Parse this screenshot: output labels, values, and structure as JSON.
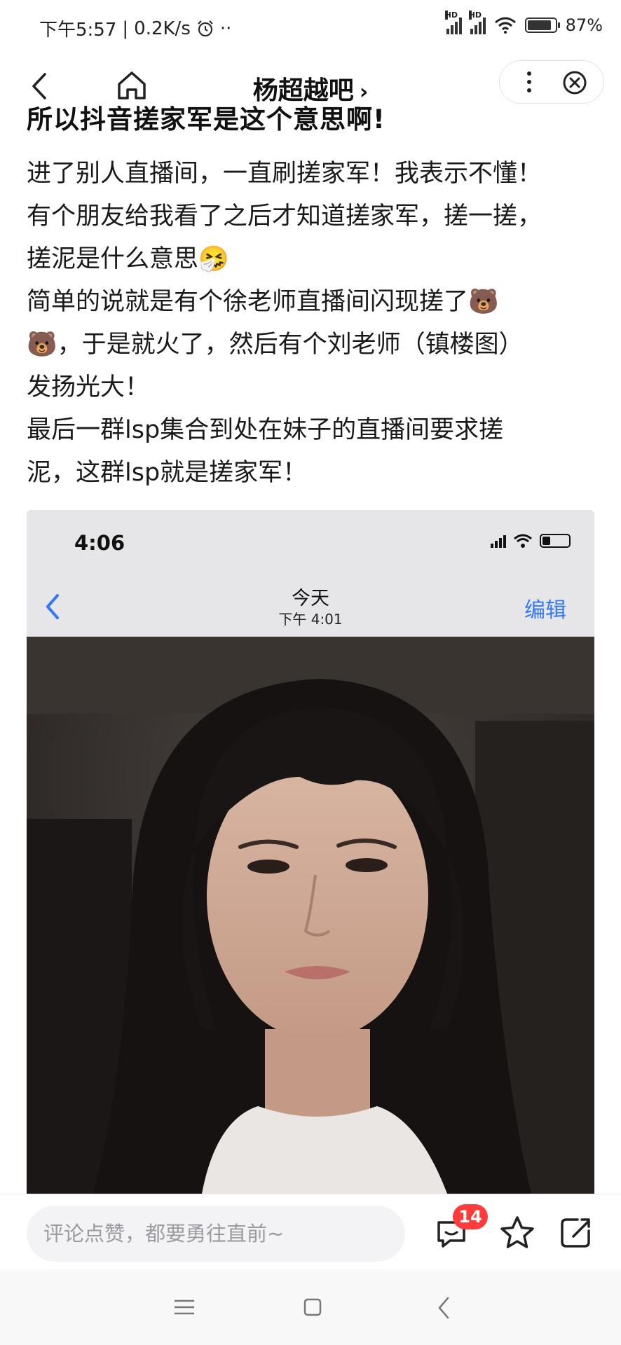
{
  "status_bar": {
    "time": "下午5:57",
    "speed": "0.2K/s",
    "extra": "··",
    "hd1": "HD",
    "hd2": "HD",
    "battery": "87%",
    "battery_level": 0.87
  },
  "nav": {
    "title": "杨超越吧",
    "title_chevron": "›",
    "icons": [
      "back-arrow-icon",
      "home-icon",
      "more-dots-icon",
      "close-circle-icon"
    ]
  },
  "post": {
    "title": "所以抖音搓家军是这个意思啊!",
    "paragraphs": [
      "进了别人直播间，一直刷搓家军！我表示不懂！",
      "有个朋友给我看了之后才知道搓家军，搓一搓，",
      "搓泥是什么意思🤧",
      "简单的说就是有个徐老师直播间闪现搓了🐻",
      "🐻，于是就火了，然后有个刘老师（镇楼图）",
      "发扬光大！",
      "最后一群lsp集合到处在妹子的直播间要求搓",
      "泥，这群lsp就是搓家军！"
    ]
  },
  "embedded_screenshot": {
    "time": "4:06",
    "title": "今天",
    "subtitle": "下午 4:01",
    "edit_label": "编辑",
    "battery_level": 0.3
  },
  "bottom_bar": {
    "comment_placeholder": "评论点赞，都要勇往直前~",
    "comment_count": "14"
  },
  "colors": {
    "accent_blue": "#3478f6",
    "badge_red": "#ff3b3b",
    "input_bg": "#f3f3f5"
  }
}
